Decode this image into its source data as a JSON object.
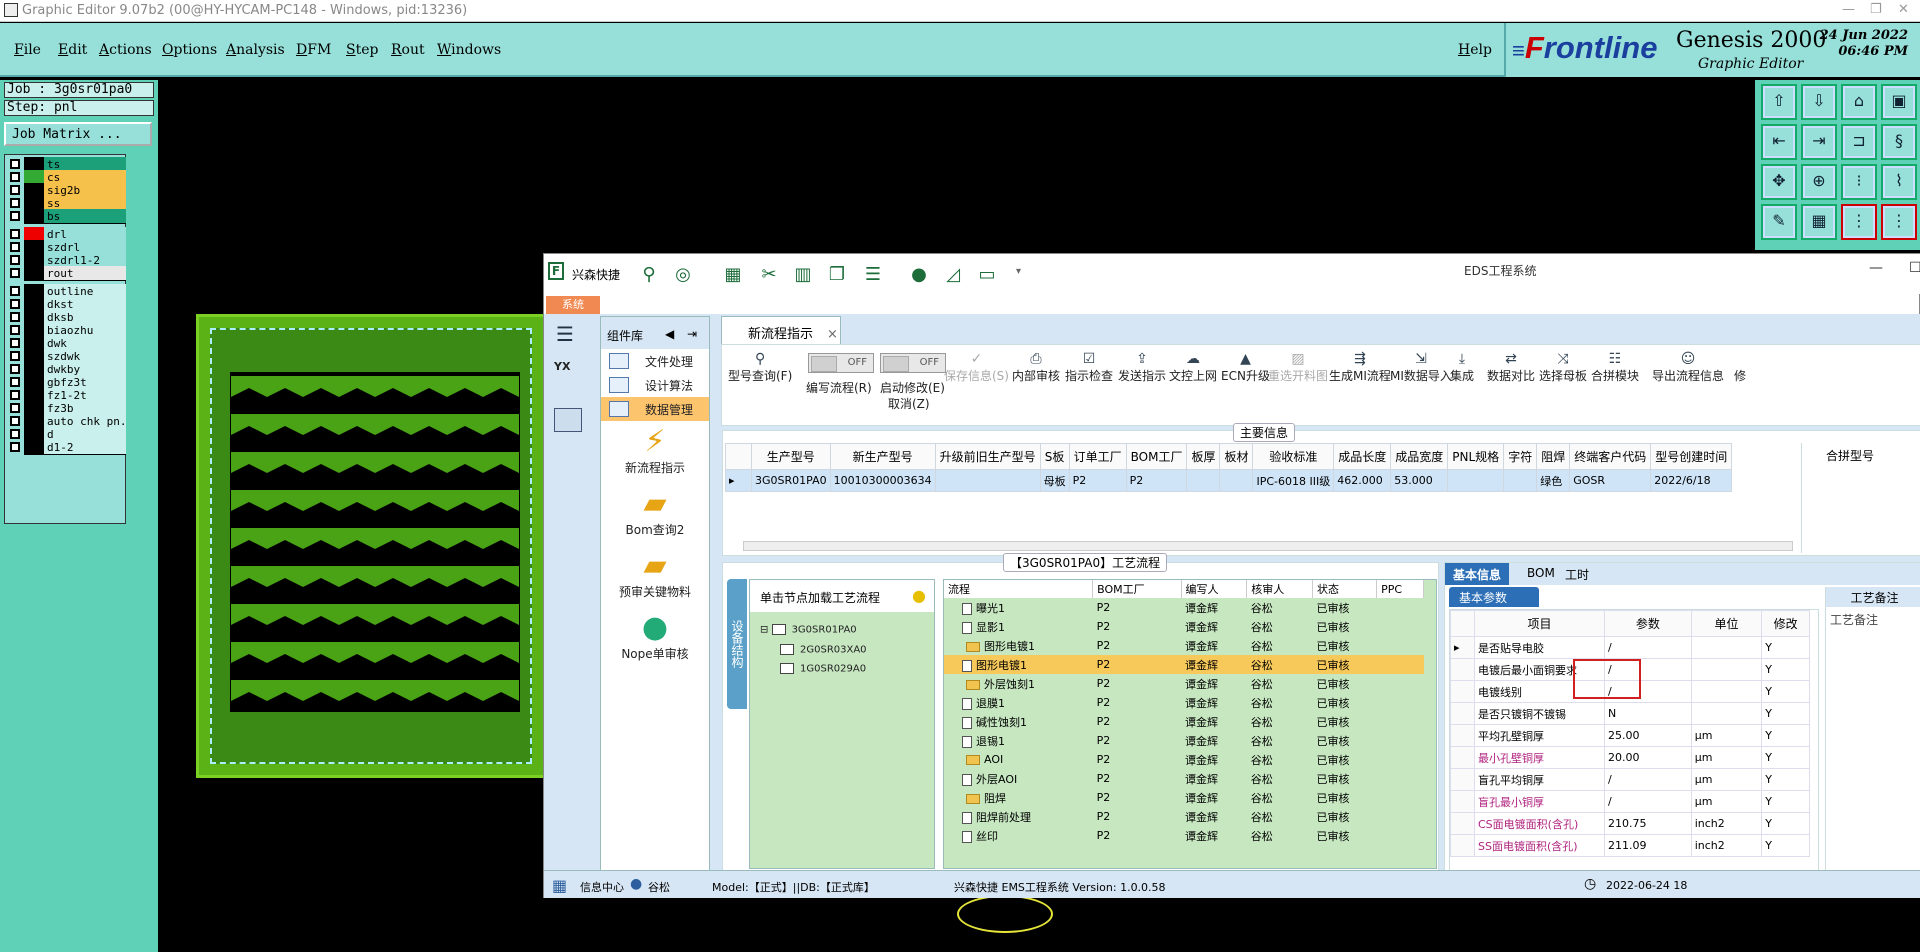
{
  "titlebar": {
    "title": "Graphic Editor 9.07b2 (00@HY-HYCAM-PC148 - Windows, pid:13236)"
  },
  "menu": {
    "items": [
      "File",
      "Edit",
      "Actions",
      "Options",
      "Analysis",
      "DFM",
      "Step",
      "Rout",
      "Windows"
    ],
    "help": "Help"
  },
  "brand": {
    "logo_f": "F",
    "logo_rest": "rontline",
    "product": "Genesis 2000",
    "subtitle": "Graphic Editor",
    "date": "24 Jun 2022",
    "time": "06:46 PM"
  },
  "job": {
    "job_line": "Job : 3g0sr01pa0",
    "step_line": "Step: pnl",
    "matrix_button": "Job Matrix ..."
  },
  "layers": [
    {
      "name": "ts",
      "color": "#1ca07a",
      "swatch": "#000"
    },
    {
      "name": "cs",
      "color": "#f6c14b",
      "swatch": "#3a3"
    },
    {
      "name": "sig2b",
      "color": "#f6c14b",
      "swatch": "#000"
    },
    {
      "name": "ss",
      "color": "#f6c14b",
      "swatch": "#000"
    },
    {
      "name": "bs",
      "color": "#1ca07a",
      "swatch": "#000"
    },
    {
      "name": "drl",
      "color": "#96e0d9",
      "swatch": "#e00"
    },
    {
      "name": "szdrl",
      "color": "#96e0d9",
      "swatch": "#000"
    },
    {
      "name": "szdrl1-2",
      "color": "#96e0d9",
      "swatch": "#000"
    },
    {
      "name": "rout",
      "color": "#e8e8e8",
      "swatch": "#000"
    },
    {
      "name": "outline",
      "color": "#c9f0ec",
      "swatch": "#000"
    },
    {
      "name": "dkst",
      "color": "#c9f0ec",
      "swatch": "#000"
    },
    {
      "name": "dksb",
      "color": "#c9f0ec",
      "swatch": "#000"
    },
    {
      "name": "biaozhu",
      "color": "#c9f0ec",
      "swatch": "#000"
    },
    {
      "name": "dwk",
      "color": "#c9f0ec",
      "swatch": "#000"
    },
    {
      "name": "szdwk",
      "color": "#c9f0ec",
      "swatch": "#000"
    },
    {
      "name": "dwkby",
      "color": "#c9f0ec",
      "swatch": "#000"
    },
    {
      "name": "gbfz3t",
      "color": "#c9f0ec",
      "swatch": "#000"
    },
    {
      "name": "fz1-2t",
      "color": "#c9f0ec",
      "swatch": "#000"
    },
    {
      "name": "fz3b",
      "color": "#c9f0ec",
      "swatch": "#000"
    },
    {
      "name": "auto_chk_pn.",
      "color": "#c9f0ec",
      "swatch": "#000"
    },
    {
      "name": "d",
      "color": "#c9f0ec",
      "swatch": "#000"
    },
    {
      "name": "d1-2",
      "color": "#c9f0ec",
      "swatch": "#000"
    }
  ],
  "eds": {
    "title": "EDS工程系统",
    "toolbar_label": "兴森快捷",
    "sys_tab": "系统",
    "comp_lib": "组件库",
    "comp_items": [
      "文件处理",
      "设计算法",
      "数据管理"
    ],
    "comp_big": [
      "新流程指示",
      "Bom查询2",
      "预审关键物料",
      "Nope单审核"
    ],
    "doc_tab": "新流程指示",
    "ribbon": {
      "type_query": "型号查询(F)",
      "edit_flow": "编写流程(R)",
      "start_edit": "启动修改(E)",
      "cancel": "取消(Z)",
      "toggle_off": "OFF",
      "save": "保存信息(S)",
      "items": [
        "内部审核",
        "指示检查",
        "发送指示",
        "文控上网",
        "ECN升级",
        "重选开料图",
        "生成MI流程",
        "MI数据导入",
        "集成",
        "数据对比",
        "选择母板",
        "合拼模块",
        "导出流程信息",
        "修"
      ]
    },
    "main_info": {
      "title": "主要信息",
      "headers": [
        "生产型号",
        "新生产型号",
        "升级前旧生产型号",
        "S板",
        "订单工厂",
        "BOM工厂",
        "板厚",
        "板材",
        "验收标准",
        "成品长度",
        "成品宽度",
        "PNL规格",
        "字符",
        "阻焊",
        "终端客户代码",
        "型号创建时间"
      ],
      "row": [
        "3G0SR01PA0",
        "10010300003634",
        "",
        "母板",
        "P2",
        "P2",
        "",
        "",
        "IPC-6018 III级",
        "462.000",
        "53.000",
        "",
        "",
        "绿色",
        "GOSR",
        "2022/6/18"
      ],
      "side_header": "合拼型号"
    },
    "flow": {
      "title": "【3G0SR01PA0】工艺流程",
      "side_label": "设备结构",
      "tree_head": "单击节点加载工艺流程",
      "tree_nodes": [
        "3G0SR01PA0",
        "2G0SR03XA0",
        "1G0SR029A0"
      ],
      "headers": [
        "流程",
        "BOM工厂",
        "编写人",
        "核审人",
        "状态",
        "PPC"
      ],
      "rows": [
        {
          "kind": "doc",
          "name": "曝光1",
          "f": "P2",
          "w": "谭金辉",
          "r": "谷松",
          "s": "已审核"
        },
        {
          "kind": "doc",
          "name": "显影1",
          "f": "P2",
          "w": "谭金辉",
          "r": "谷松",
          "s": "已审核"
        },
        {
          "kind": "folder",
          "name": "图形电镀1",
          "f": "P2",
          "w": "谭金辉",
          "r": "谷松",
          "s": "已审核"
        },
        {
          "kind": "doc",
          "name": "图形电镀1",
          "f": "P2",
          "w": "谭金辉",
          "r": "谷松",
          "s": "已审核",
          "hl": true
        },
        {
          "kind": "folder",
          "name": "外层蚀刻1",
          "f": "P2",
          "w": "谭金辉",
          "r": "谷松",
          "s": "已审核"
        },
        {
          "kind": "doc",
          "name": "退膜1",
          "f": "P2",
          "w": "谭金辉",
          "r": "谷松",
          "s": "已审核"
        },
        {
          "kind": "doc",
          "name": "碱性蚀刻1",
          "f": "P2",
          "w": "谭金辉",
          "r": "谷松",
          "s": "已审核"
        },
        {
          "kind": "doc",
          "name": "退锡1",
          "f": "P2",
          "w": "谭金辉",
          "r": "谷松",
          "s": "已审核"
        },
        {
          "kind": "folder",
          "name": "AOI",
          "f": "P2",
          "w": "谭金辉",
          "r": "谷松",
          "s": "已审核"
        },
        {
          "kind": "doc",
          "name": "外层AOI",
          "f": "P2",
          "w": "谭金辉",
          "r": "谷松",
          "s": "已审核"
        },
        {
          "kind": "folder",
          "name": "阻焊",
          "f": "P2",
          "w": "谭金辉",
          "r": "谷松",
          "s": "已审核"
        },
        {
          "kind": "doc",
          "name": "阻焊前处理",
          "f": "P2",
          "w": "谭金辉",
          "r": "谷松",
          "s": "已审核"
        },
        {
          "kind": "doc",
          "name": "丝印",
          "f": "P2",
          "w": "谭金辉",
          "r": "谷松",
          "s": "已审核"
        }
      ]
    },
    "params": {
      "tabs": [
        "基本信息",
        "BOM",
        "工时"
      ],
      "sub": "基本参数",
      "notes": "工艺备注",
      "notes_label": "工艺备注",
      "headers": [
        "项目",
        "参数",
        "单位",
        "修改"
      ],
      "rows": [
        {
          "item": "是否贴导电胶",
          "val": "/",
          "unit": "",
          "mod": "Y",
          "pink": false
        },
        {
          "item": "电镀后最小面铜要求",
          "val": "/",
          "unit": "",
          "mod": "Y",
          "pink": false
        },
        {
          "item": "电镀线别",
          "val": "/",
          "unit": "",
          "mod": "Y",
          "pink": false
        },
        {
          "item": "是否只镀铜不镀锡",
          "val": "N",
          "unit": "",
          "mod": "Y",
          "pink": false
        },
        {
          "item": "平均孔壁铜厚",
          "val": "25.00",
          "unit": "μm",
          "mod": "Y",
          "pink": false
        },
        {
          "item": "最小孔壁铜厚",
          "val": "20.00",
          "unit": "μm",
          "mod": "Y",
          "pink": true
        },
        {
          "item": "盲孔平均铜厚",
          "val": "/",
          "unit": "μm",
          "mod": "Y",
          "pink": false
        },
        {
          "item": "盲孔最小铜厚",
          "val": "/",
          "unit": "μm",
          "mod": "Y",
          "pink": true
        },
        {
          "item": "CS面电镀面积(含孔)",
          "val": "210.75",
          "unit": "inch2",
          "mod": "Y",
          "pink": true
        },
        {
          "item": "SS面电镀面积(含孔)",
          "val": "211.09",
          "unit": "inch2",
          "mod": "Y",
          "pink": true
        }
      ]
    },
    "status": {
      "info": "信息中心",
      "user": "谷松",
      "model": "Model:【正式】||DB:【正式库】",
      "version": "兴森快捷 EMS工程系统 Version: 1.0.0.58",
      "date": "2022-06-24 18"
    }
  }
}
